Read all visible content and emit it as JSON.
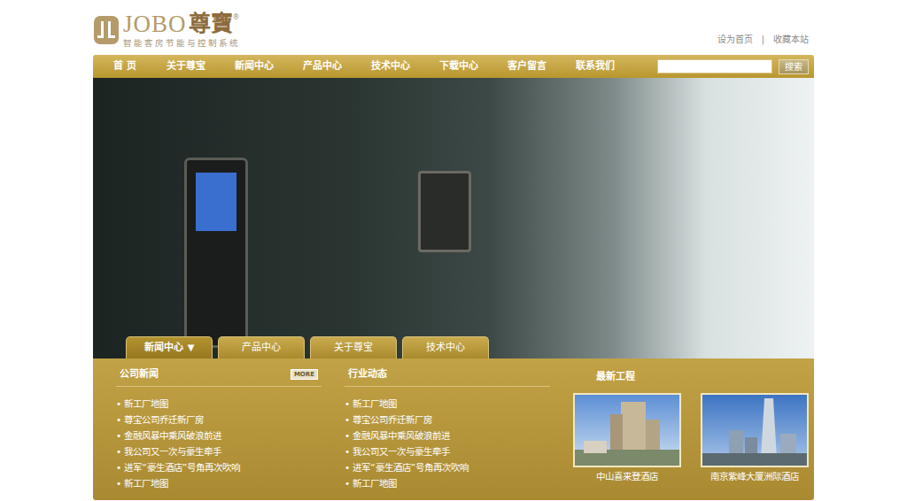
{
  "header": {
    "logo": {
      "brand": "JOBO",
      "brand_cn": "尊寶",
      "mark": "®",
      "subtitle": "智能客房节能与控制系统"
    },
    "links": [
      "设为首页",
      "收藏本站"
    ],
    "separator": "|"
  },
  "nav": {
    "items": [
      "首 页",
      "关于尊宝",
      "新闻中心",
      "产品中心",
      "技术中心",
      "下载中心",
      "客户留言",
      "联系我们"
    ],
    "search": {
      "button": "搜索"
    }
  },
  "tab_arrow": "▼",
  "tabs": [
    {
      "label": "新闻中心",
      "selected": true
    },
    {
      "label": "产品中心",
      "selected": false
    },
    {
      "label": "关于尊宝",
      "selected": false
    },
    {
      "label": "技术中心",
      "selected": false
    }
  ],
  "bullet": "•",
  "news": {
    "title": "公司新闻",
    "more": "MORE",
    "items": [
      "新工厂地图",
      "尊宝公司乔迁新厂房",
      "金融风暴中乘风破浪前进",
      "我公司又一次与豪生牵手",
      "进军“豪生酒店”号角再次吹响",
      "新工厂地图"
    ]
  },
  "industry": {
    "title": "行业动态",
    "items": [
      "新工厂地图",
      "尊宝公司乔迁新厂房",
      "金融风暴中乘风破浪前进",
      "我公司又一次与豪生牵手",
      "进军“豪生酒店”号角再次吹响",
      "新工厂地图"
    ]
  },
  "projects": {
    "title": "最新工程",
    "items": [
      {
        "caption": "中山喜来登酒店"
      },
      {
        "caption": "南京紫峰大厦洲际酒店"
      }
    ]
  }
}
